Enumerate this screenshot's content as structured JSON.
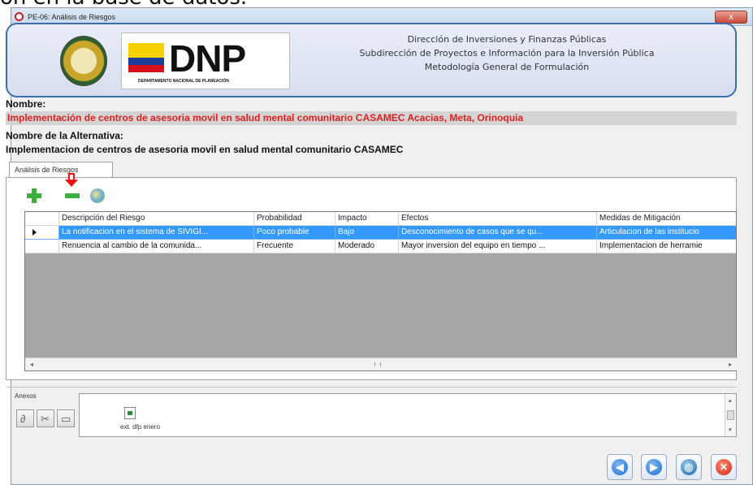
{
  "background_text": "ón en la base de datos.",
  "window": {
    "title": "PE-06: Análisis de Riesgos",
    "close_label": "x"
  },
  "banner": {
    "logo_text": "DNP",
    "logo_subtitle": "DEPARTAMENTO NACIONAL DE PLANEACIÓN",
    "line1": "Dirección de Inversiones y Finanzas Públicas",
    "line2": "Subdirección de Proyectos e Información para la Inversión Pública",
    "line3": "Metodología General de Formulación"
  },
  "form": {
    "nombre_label": "Nombre:",
    "nombre_value": "Implementación de centros de asesoria movil en salud mental comunitario CASAMEC Acacias, Meta, Orinoquia",
    "alternativa_label": "Nombre de la Alternativa:",
    "alternativa_value": "Implementacion de centros de asesoria movil en salud mental comunitario CASAMEC"
  },
  "tab": {
    "label": "Análisis de Riesgos"
  },
  "toolbar": {
    "add_icon": "plus-icon",
    "remove_icon": "minus-icon",
    "edit_icon": "edit-icon"
  },
  "grid": {
    "columns": [
      "Descripción del Riesgo",
      "Probabilidad",
      "Impacto",
      "Efectos",
      "Medidas de Mitigación"
    ],
    "rows": [
      [
        "La notificacion en el sistema de SIVIGI...",
        "Poco probable",
        "Bajo",
        "Desconocimiento de casos que se qu...",
        "Articulacion de las institucio"
      ],
      [
        "Renuencia al cambio de la comunida...",
        "Frecuente",
        "Moderado",
        "Mayor inversion del equipo en tiempo ...",
        "Implementacion de herramie"
      ]
    ]
  },
  "anexo": {
    "label": "Anexos",
    "file_name": "ext. dfp enero"
  },
  "colors": {
    "selection": "#3399ff",
    "title_red": "#e02020",
    "banner_border": "#3a6fb0"
  }
}
